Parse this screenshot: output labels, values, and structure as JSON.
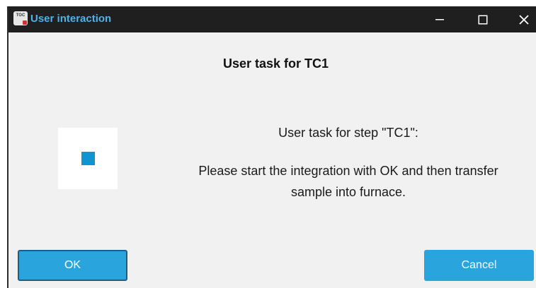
{
  "window": {
    "title": "User interaction",
    "icon_label": "TOC",
    "controls": {
      "minimize": "minimize-icon",
      "maximize": "maximize-icon",
      "close": "close-icon"
    }
  },
  "dialog": {
    "heading": "User task for TC1",
    "message_line1": "User task for step \"TC1\":",
    "message_line2": "Please start the integration with OK and then transfer",
    "message_line3": "sample into furnace.",
    "status_color": "#0f93d1"
  },
  "buttons": {
    "ok_label": "OK",
    "cancel_label": "Cancel"
  },
  "colors": {
    "titlebar": "#1f1f1f",
    "title_text": "#4fb3ea",
    "button": "#2aa4dd",
    "background": "#f1f1f1"
  }
}
